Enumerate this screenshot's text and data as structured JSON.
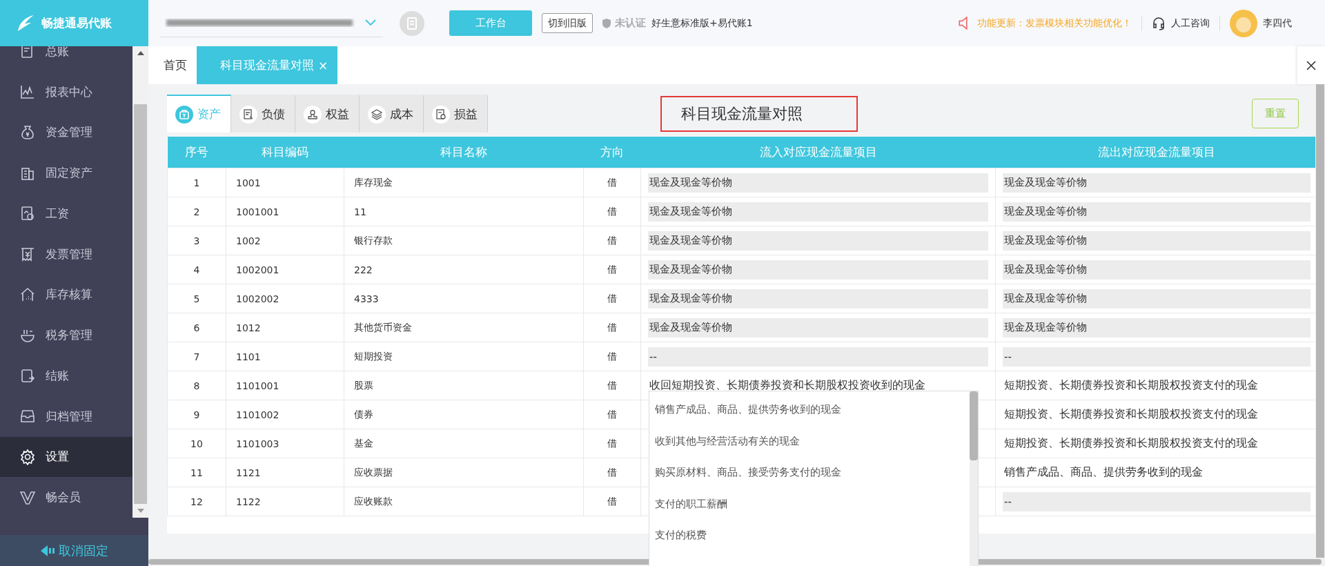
{
  "app": {
    "logo_text": "畅捷通易代账"
  },
  "top_bar": {
    "workbench_button": "工作台",
    "old_version_button": "切到旧版",
    "cert_status": "未认证",
    "edition": "好生意标准版+易代账1",
    "notice": "功能更新：发票模块相关功能优化！",
    "support": "人工咨询",
    "user_name": "李四代"
  },
  "sidebar": {
    "items": [
      {
        "label": "总账",
        "selected": false
      },
      {
        "label": "报表中心",
        "selected": false
      },
      {
        "label": "资金管理",
        "selected": false
      },
      {
        "label": "固定资产",
        "selected": false
      },
      {
        "label": "工资",
        "selected": false
      },
      {
        "label": "发票管理",
        "selected": false
      },
      {
        "label": "库存核算",
        "selected": false
      },
      {
        "label": "税务管理",
        "selected": false
      },
      {
        "label": "结账",
        "selected": false
      },
      {
        "label": "归档管理",
        "selected": false
      },
      {
        "label": "设置",
        "selected": true
      },
      {
        "label": "畅会员",
        "selected": false
      }
    ],
    "unpin": "取消固定"
  },
  "page_tabs": [
    {
      "label": "首页",
      "selected": false,
      "closable": false
    },
    {
      "label": "科目现金流量对照",
      "selected": true,
      "closable": true
    }
  ],
  "page_tab_close": "×",
  "category_tabs": [
    {
      "label": "资产",
      "selected": true
    },
    {
      "label": "负债",
      "selected": false
    },
    {
      "label": "权益",
      "selected": false
    },
    {
      "label": "成本",
      "selected": false
    },
    {
      "label": "损益",
      "selected": false
    }
  ],
  "title": "科目现金流量对照",
  "reset_button": "重置",
  "table": {
    "columns": [
      "序号",
      "科目编码",
      "科目名称",
      "方向",
      "流入对应现金流量项目",
      "流出对应现金流量项目"
    ],
    "rows": [
      {
        "no": "1",
        "code": "1001",
        "name": "库存现金",
        "dir": "借",
        "inflow": {
          "text": "现金及现金等价物",
          "shaded": true
        },
        "outflow": {
          "text": "现金及现金等价物",
          "shaded": true
        }
      },
      {
        "no": "2",
        "code": "1001001",
        "name": "11",
        "dir": "借",
        "inflow": {
          "text": "现金及现金等价物",
          "shaded": true
        },
        "outflow": {
          "text": "现金及现金等价物",
          "shaded": true
        }
      },
      {
        "no": "3",
        "code": "1002",
        "name": "银行存款",
        "dir": "借",
        "inflow": {
          "text": "现金及现金等价物",
          "shaded": true
        },
        "outflow": {
          "text": "现金及现金等价物",
          "shaded": true
        }
      },
      {
        "no": "4",
        "code": "1002001",
        "name": "222",
        "dir": "借",
        "inflow": {
          "text": "现金及现金等价物",
          "shaded": true
        },
        "outflow": {
          "text": "现金及现金等价物",
          "shaded": true
        }
      },
      {
        "no": "5",
        "code": "1002002",
        "name": "4333",
        "dir": "借",
        "inflow": {
          "text": "现金及现金等价物",
          "shaded": true
        },
        "outflow": {
          "text": "现金及现金等价物",
          "shaded": true
        }
      },
      {
        "no": "6",
        "code": "1012",
        "name": "其他货币资金",
        "dir": "借",
        "inflow": {
          "text": "现金及现金等价物",
          "shaded": true
        },
        "outflow": {
          "text": "现金及现金等价物",
          "shaded": true
        }
      },
      {
        "no": "7",
        "code": "1101",
        "name": "短期投资",
        "dir": "借",
        "inflow": {
          "text": "--",
          "shaded": true
        },
        "outflow": {
          "text": "--",
          "shaded": true
        }
      },
      {
        "no": "8",
        "code": "1101001",
        "name": "股票",
        "dir": "借",
        "inflow": {
          "text": "收回短期投资、长期债券投资和长期股权投资收到的现金",
          "shaded": false
        },
        "outflow": {
          "text": "短期投资、长期债券投资和长期股权投资支付的现金",
          "shaded": false
        }
      },
      {
        "no": "9",
        "code": "1101002",
        "name": "债券",
        "dir": "借",
        "inflow": null,
        "outflow": {
          "text": "短期投资、长期债券投资和长期股权投资支付的现金",
          "shaded": false
        }
      },
      {
        "no": "10",
        "code": "1101003",
        "name": "基金",
        "dir": "借",
        "inflow": null,
        "outflow": {
          "text": "短期投资、长期债券投资和长期股权投资支付的现金",
          "shaded": false
        }
      },
      {
        "no": "11",
        "code": "1121",
        "name": "应收票据",
        "dir": "借",
        "inflow": null,
        "outflow": {
          "text": "销售产成品、商品、提供劳务收到的现金",
          "shaded": false
        }
      },
      {
        "no": "12",
        "code": "1122",
        "name": "应收账款",
        "dir": "借",
        "inflow": null,
        "outflow": {
          "text": "--",
          "shaded": true
        }
      }
    ]
  },
  "dropdown": {
    "options": [
      "销售产成品、商品、提供劳务收到的现金",
      "收到其他与经营活动有关的现金",
      "购买原材料、商品、接受劳务支付的现金",
      "支付的职工薪酬",
      "支付的税费"
    ]
  }
}
